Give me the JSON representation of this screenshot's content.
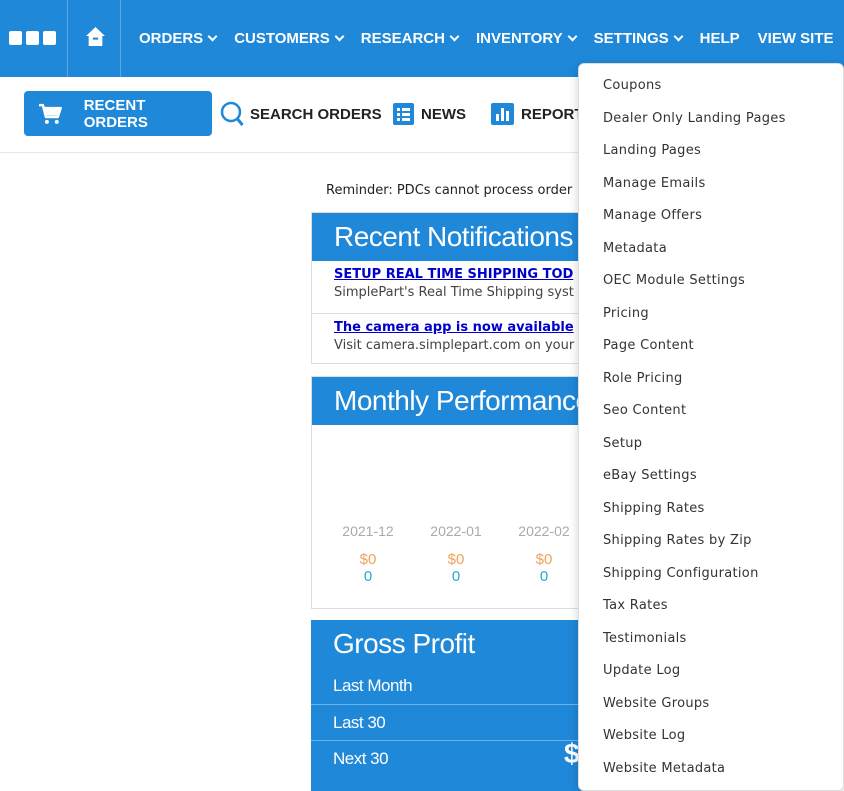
{
  "topnav": {
    "items": [
      {
        "label": "ORDERS",
        "dropdown": true
      },
      {
        "label": "CUSTOMERS",
        "dropdown": true
      },
      {
        "label": "RESEARCH",
        "dropdown": true
      },
      {
        "label": "INVENTORY",
        "dropdown": true
      },
      {
        "label": "SETTINGS",
        "dropdown": true
      },
      {
        "label": "HELP",
        "dropdown": false
      },
      {
        "label": "VIEW SITE",
        "dropdown": false
      }
    ],
    "grid_icon": "apps-grid-icon",
    "home_icon": "home-icon"
  },
  "subnav": {
    "recent_orders": "RECENT ORDERS",
    "search_orders": "SEARCH ORDERS",
    "news": "NEWS",
    "reports": "REPORT"
  },
  "main": {
    "reminder": "Reminder: PDCs cannot process order",
    "notifications": {
      "title": "Recent Notifications",
      "items": [
        {
          "link": "SETUP REAL TIME SHIPPING TOD",
          "text": "SimplePart's Real Time Shipping syst"
        },
        {
          "link": "The camera app is now available",
          "text": "Visit camera.simplepart.com on your"
        }
      ]
    },
    "performance": {
      "title": "Monthly Performance",
      "months": [
        {
          "month": "2021-12",
          "value": "$0",
          "count": "0"
        },
        {
          "month": "2022-01",
          "value": "$0",
          "count": "0"
        },
        {
          "month": "2022-02",
          "value": "$0",
          "count": "0"
        }
      ]
    },
    "gross_profit": {
      "title": "Gross Profit",
      "rows": [
        "Last Month",
        "Last 30",
        "Next 30"
      ],
      "big_value": "$"
    }
  },
  "settings_menu": {
    "items": [
      "Coupons",
      "Dealer Only Landing Pages",
      "Landing Pages",
      "Manage Emails",
      "Manage Offers",
      "Metadata",
      "OEC Module Settings",
      "Pricing",
      "Page Content",
      "Role Pricing",
      "Seo Content",
      "Setup",
      "eBay Settings",
      "Shipping Rates",
      "Shipping Rates by Zip",
      "Shipping Configuration",
      "Tax Rates",
      "Testimonials",
      "Update Log",
      "Website Groups",
      "Website Log",
      "Website Metadata"
    ]
  },
  "colors": {
    "primary": "#1f88d8",
    "money": "#f0a25a",
    "count": "#29a8d8",
    "link": "#0000cc"
  }
}
